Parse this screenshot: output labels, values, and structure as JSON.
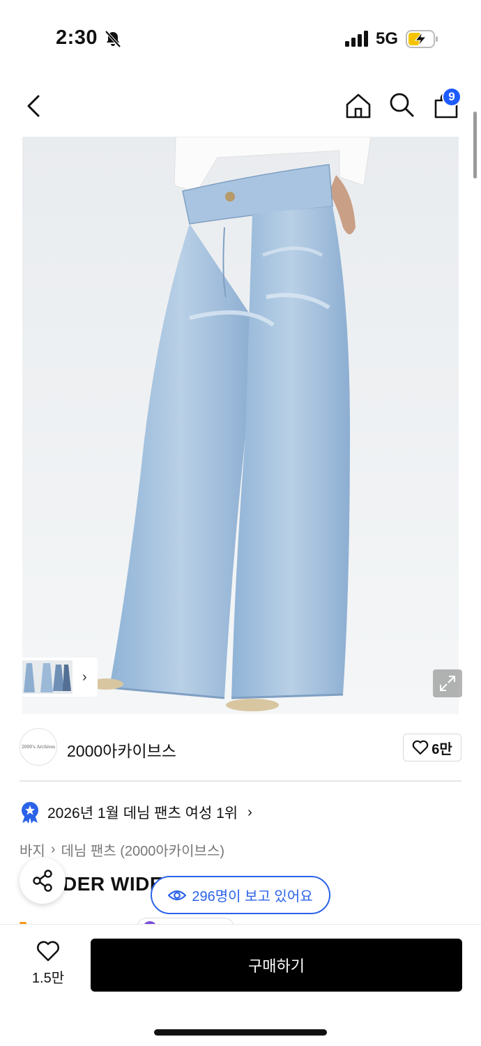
{
  "status_bar": {
    "time": "2:30",
    "network": "5G",
    "icons": [
      "bell-slash-icon",
      "signal-bars-icon",
      "battery-charging-icon"
    ],
    "battery_color": "#f5c400"
  },
  "nav": {
    "icons": [
      "chevron-left-icon",
      "home-icon",
      "search-icon",
      "shopping-bag-icon"
    ],
    "cart_badge": "9",
    "badge_color": "#1f5cff"
  },
  "gallery": {
    "image_subject": "light-wash wide leg denim jeans",
    "thumb_chevron": "›"
  },
  "brand": {
    "logo_text": "2000's Archives",
    "name": "2000아카이브스",
    "like_count": "6만"
  },
  "ranking": {
    "text": "2026년 1월 데님 팬츠 여성 1위",
    "chevron": "›",
    "badge_color": "#2b63e8"
  },
  "breadcrumb": {
    "items": [
      "바지",
      "데님 팬츠 (2000아카이브스)"
    ],
    "separator": "›"
  },
  "product": {
    "title_partial": "DER WIDE"
  },
  "viewers": {
    "text": "296명이 보고 있어요",
    "accent_color": "#2b63e8"
  },
  "bottom_bar": {
    "wish_count": "1.5만",
    "buy_label": "구매하기"
  }
}
